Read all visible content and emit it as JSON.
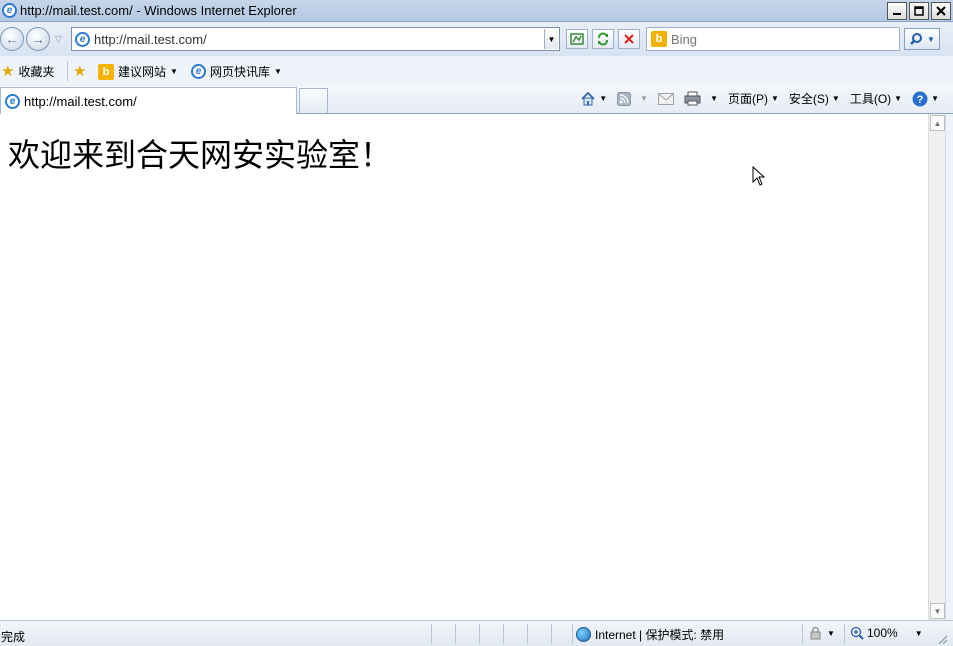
{
  "window": {
    "title": "http://mail.test.com/ - Windows Internet Explorer"
  },
  "address_bar": {
    "url": "http://mail.test.com/"
  },
  "search": {
    "placeholder": "Bing"
  },
  "favorites_bar": {
    "favorites_label": "收藏夹",
    "links": [
      {
        "label": "建议网站",
        "icon": "bing-icon"
      },
      {
        "label": "网页快讯库",
        "icon": "ie-page-icon"
      }
    ]
  },
  "tab": {
    "label": "http://mail.test.com/"
  },
  "command_bar": {
    "page_label": "页面(P)",
    "safety_label": "安全(S)",
    "tools_label": "工具(O)"
  },
  "page": {
    "heading": "欢迎来到合天网安实验室！"
  },
  "status_bar": {
    "status": "完成",
    "zone": "Internet | 保护模式: 禁用",
    "zoom": "100%"
  }
}
